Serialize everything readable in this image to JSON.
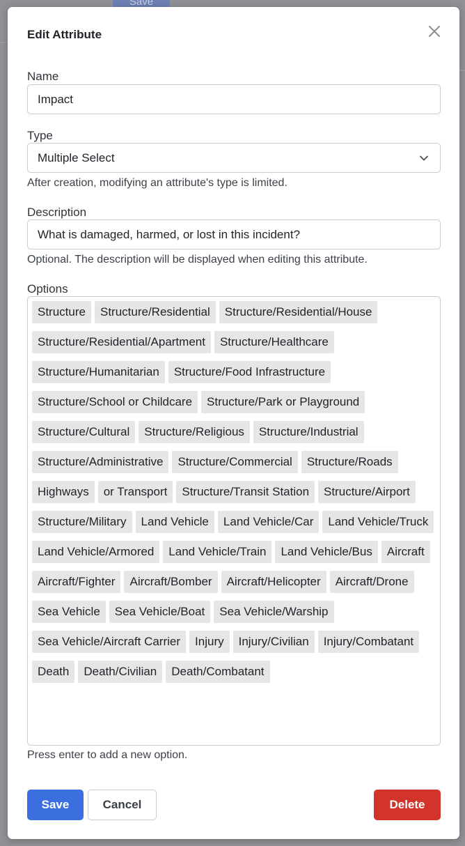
{
  "background": {
    "save_label": "Save"
  },
  "modal": {
    "title": "Edit Attribute",
    "close_icon": "close-icon",
    "name": {
      "label": "Name",
      "value": "Impact"
    },
    "type": {
      "label": "Type",
      "selected": "Multiple Select",
      "help": "After creation, modifying an attribute's type is limited."
    },
    "description": {
      "label": "Description",
      "value": "What is damaged, harmed, or lost in this incident?",
      "help": "Optional. The description will be displayed when editing this attribute."
    },
    "options": {
      "label": "Options",
      "items": [
        "Structure",
        "Structure/Residential",
        "Structure/Residential/House",
        "Structure/Residential/Apartment",
        "Structure/Healthcare",
        "Structure/Humanitarian",
        "Structure/Food Infrastructure",
        "Structure/School or Childcare",
        "Structure/Park or Playground",
        "Structure/Cultural",
        "Structure/Religious",
        "Structure/Industrial",
        "Structure/Administrative",
        "Structure/Commercial",
        "Structure/Roads",
        "Highways",
        "or Transport",
        "Structure/Transit Station",
        "Structure/Airport",
        "Structure/Military",
        "Land Vehicle",
        "Land Vehicle/Car",
        "Land Vehicle/Truck",
        "Land Vehicle/Armored",
        "Land Vehicle/Train",
        "Land Vehicle/Bus",
        "Aircraft",
        "Aircraft/Fighter",
        "Aircraft/Bomber",
        "Aircraft/Helicopter",
        "Aircraft/Drone",
        "Sea Vehicle",
        "Sea Vehicle/Boat",
        "Sea Vehicle/Warship",
        "Sea Vehicle/Aircraft Carrier",
        "Injury",
        "Injury/Civilian",
        "Injury/Combatant",
        "Death",
        "Death/Civilian",
        "Death/Combatant"
      ],
      "help": "Press enter to add a new option."
    },
    "buttons": {
      "save": "Save",
      "cancel": "Cancel",
      "delete": "Delete"
    }
  },
  "colors": {
    "primary": "#3b6fe0",
    "danger": "#d2342b",
    "tag_bg": "#e6e6e6"
  }
}
